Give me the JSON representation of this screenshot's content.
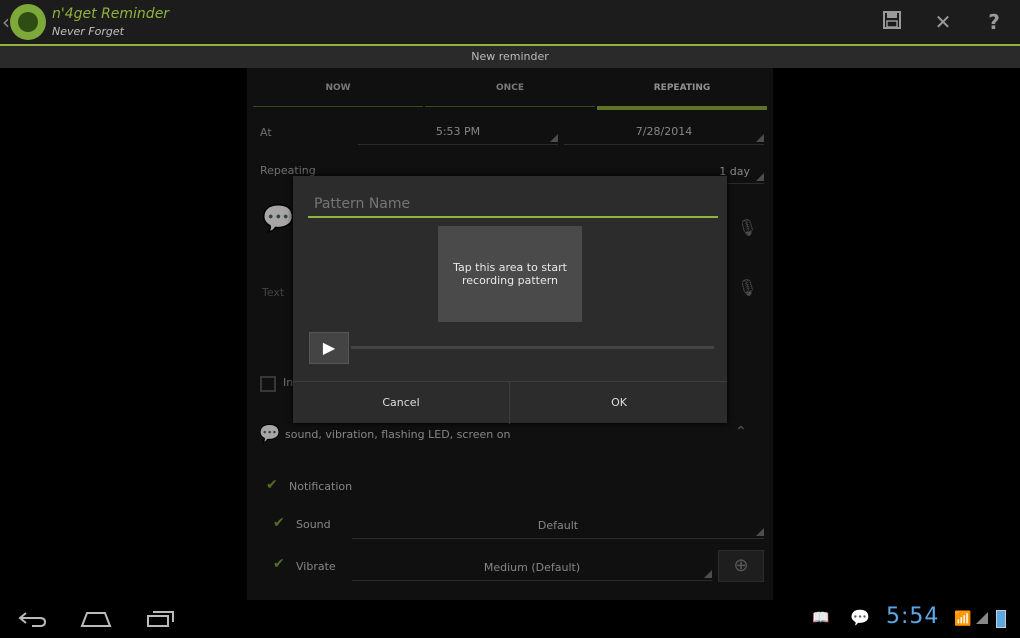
{
  "app": {
    "title": "n'4get Reminder",
    "subtitle": "Never Forget",
    "back_icon": "chevron-left-icon",
    "logo_icon": "app-logo-icon"
  },
  "actionbar": {
    "save_icon": "save-icon",
    "close_icon": "close-icon",
    "help_icon": "help-icon"
  },
  "screen_title": "New reminder",
  "tabs": [
    {
      "label": "NOW",
      "active": false
    },
    {
      "label": "ONCE",
      "active": false
    },
    {
      "label": "REPEATING",
      "active": true
    }
  ],
  "form": {
    "at_label": "At",
    "time_value": "5:53 PM",
    "date_value": "7/28/2014",
    "repeating_label": "Repeating",
    "repeating_value": "1 day",
    "text_placeholder": "Text",
    "checkbox_partial_label": "In",
    "notif_summary": "sound, vibration, flashing LED, screen on",
    "notification_label": "Notification",
    "sound_label": "Sound",
    "sound_value": "Default",
    "vibrate_label": "Vibrate",
    "vibrate_value": "Medium (Default)"
  },
  "dialog": {
    "pattern_placeholder": "Pattern Name",
    "record_area_text": "Tap this area to start recording pattern",
    "cancel_label": "Cancel",
    "ok_label": "OK"
  },
  "statusbar": {
    "time": "5:54"
  },
  "colors": {
    "accent": "#8fb33c",
    "clock": "#5aa9e6"
  }
}
